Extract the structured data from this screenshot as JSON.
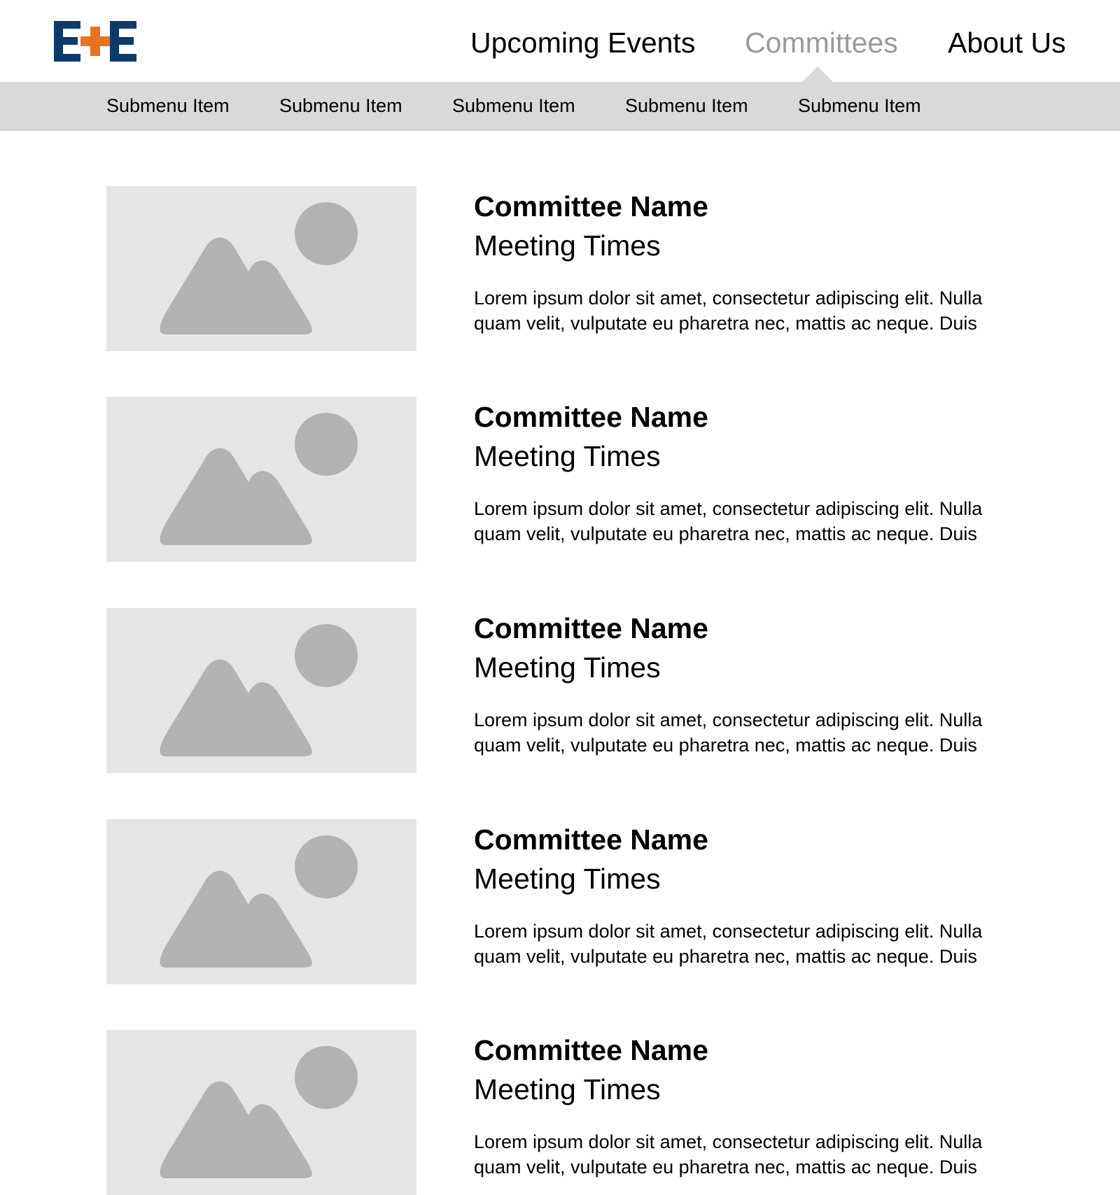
{
  "colors": {
    "brand_navy": "#0c3a6a",
    "brand_orange": "#e8731f",
    "nav_active": "#999999",
    "submenu_bg": "#d9d9d9",
    "placeholder_bg": "#e5e5e5",
    "placeholder_shape": "#b2b2b2"
  },
  "logo": {
    "text": "E+E",
    "icon": "e-plus-e-logo"
  },
  "nav": {
    "items": [
      {
        "label": "Upcoming Events",
        "active": false
      },
      {
        "label": "Committees",
        "active": true
      },
      {
        "label": "About Us",
        "active": false
      }
    ]
  },
  "submenu": {
    "items": [
      {
        "label": "Submenu Item"
      },
      {
        "label": "Submenu Item"
      },
      {
        "label": "Submenu Item"
      },
      {
        "label": "Submenu Item"
      },
      {
        "label": "Submenu Item"
      }
    ]
  },
  "committees": [
    {
      "name": "Committee Name",
      "meeting": "Meeting Times",
      "description": "Lorem ipsum dolor sit amet, consectetur adipiscing elit. Nulla quam velit, vulputate eu pharetra nec, mattis ac neque. Duis",
      "image_icon": "image-placeholder-icon"
    },
    {
      "name": "Committee Name",
      "meeting": "Meeting Times",
      "description": "Lorem ipsum dolor sit amet, consectetur adipiscing elit. Nulla quam velit, vulputate eu pharetra nec, mattis ac neque. Duis",
      "image_icon": "image-placeholder-icon"
    },
    {
      "name": "Committee Name",
      "meeting": "Meeting Times",
      "description": "Lorem ipsum dolor sit amet, consectetur adipiscing elit. Nulla quam velit, vulputate eu pharetra nec, mattis ac neque. Duis",
      "image_icon": "image-placeholder-icon"
    },
    {
      "name": "Committee Name",
      "meeting": "Meeting Times",
      "description": "Lorem ipsum dolor sit amet, consectetur adipiscing elit. Nulla quam velit, vulputate eu pharetra nec, mattis ac neque. Duis",
      "image_icon": "image-placeholder-icon"
    },
    {
      "name": "Committee Name",
      "meeting": "Meeting Times",
      "description": "Lorem ipsum dolor sit amet, consectetur adipiscing elit. Nulla quam velit, vulputate eu pharetra nec, mattis ac neque. Duis",
      "image_icon": "image-placeholder-icon"
    }
  ]
}
